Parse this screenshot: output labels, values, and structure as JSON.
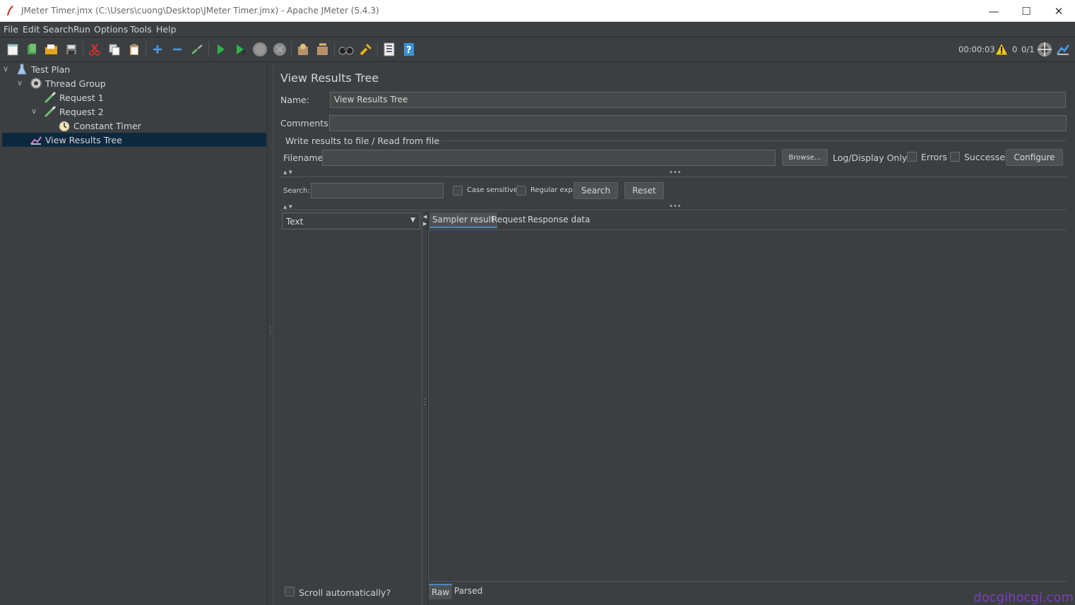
{
  "window": {
    "title": "JMeter Timer.jmx (C:\\Users\\cuong\\Desktop\\JMeter Timer.jmx) - Apache JMeter (5.4.3)",
    "minimize": "—",
    "maximize": "☐",
    "close": "✕"
  },
  "menu": [
    "File",
    "Edit",
    "Search",
    "Run",
    "Options",
    "Tools",
    "Help"
  ],
  "status": {
    "elapsed": "00:00:03",
    "warnings": "0",
    "threads": "0/1"
  },
  "tree": {
    "items": [
      {
        "label": "Test Plan",
        "icon": "flask-icon"
      },
      {
        "label": "Thread Group",
        "icon": "gear-icon"
      },
      {
        "label": "Request 1",
        "icon": "pipette-icon"
      },
      {
        "label": "Request 2",
        "icon": "pipette-icon"
      },
      {
        "label": "Constant Timer",
        "icon": "stopwatch-icon"
      },
      {
        "label": "View Results Tree",
        "icon": "chart-icon"
      }
    ],
    "selected": "View Results Tree"
  },
  "panel": {
    "heading": "View Results Tree",
    "name_label": "Name:",
    "name_value": "View Results Tree",
    "comments_label": "Comments:",
    "comments_value": "",
    "file_section": "Write results to file / Read from file",
    "filename_label": "Filename",
    "filename_value": "",
    "browse": "Browse...",
    "log_only": "Log/Display Only:",
    "errors": "Errors",
    "successes": "Successes",
    "configure": "Configure"
  },
  "search": {
    "label": "Search:",
    "value": "",
    "case_sensitive": "Case sensitive",
    "regular_exp": "Regular exp.",
    "search_btn": "Search",
    "reset_btn": "Reset"
  },
  "results": {
    "renderer": "Text",
    "tabs": [
      "Sampler result",
      "Request",
      "Response data"
    ],
    "active_tab": "Sampler result",
    "bottom_tabs": [
      "Raw",
      "Parsed"
    ],
    "active_bottom_tab": "Raw",
    "scroll_auto": "Scroll automatically?"
  },
  "watermark": "docgihocgi.com",
  "colors": {
    "background": "#3c3f41",
    "selection": "#0d293e",
    "play": "#2db54a",
    "help": "#3d8fd6"
  }
}
